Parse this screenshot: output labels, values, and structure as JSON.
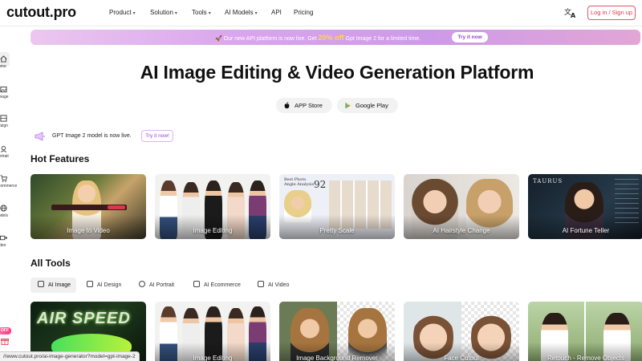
{
  "brand": {
    "logo": "cutout.pro"
  },
  "nav": {
    "items": [
      {
        "label": "Product",
        "caret": "▾"
      },
      {
        "label": "Solution",
        "caret": "▾"
      },
      {
        "label": "Tools",
        "caret": "▾"
      },
      {
        "label": "AI Models",
        "caret": "▾"
      },
      {
        "label": "API",
        "caret": ""
      },
      {
        "label": "Pricing",
        "caret": ""
      }
    ],
    "language_icon": "translate-icon",
    "login_label": "Log in / Sign up"
  },
  "sidebar": {
    "items": [
      {
        "label": "ome",
        "icon": "home-icon"
      },
      {
        "label": "mage",
        "icon": "image-icon"
      },
      {
        "label": "esign",
        "icon": "design-icon"
      },
      {
        "label": "ortrait",
        "icon": "portrait-icon"
      },
      {
        "label": "commerce",
        "icon": "cart-icon"
      },
      {
        "label": "odels",
        "icon": "models-icon"
      },
      {
        "label": "ideo",
        "icon": "video-icon"
      }
    ],
    "badge": "OFF",
    "gift_icon": "gift-icon"
  },
  "banner": {
    "prefix": "🚀 Our new API platform is now live. Get ",
    "highlight": "20% off",
    "suffix": " Gpt Image 2 for a limited time.",
    "button": "Try it now"
  },
  "hero": {
    "title": "AI Image Editing & Video Generation Platform",
    "app_store": "APP Store",
    "google_play": "Google Play"
  },
  "gpt_notice": {
    "text": "GPT Image 2 model is now live.",
    "button": "Try it now!"
  },
  "hot_features": {
    "title": "Hot Features",
    "cards": [
      {
        "label": "Image to Video"
      },
      {
        "label": "Image Editing"
      },
      {
        "label": "Pretty Scale"
      },
      {
        "label": "AI Hairstyle Change"
      },
      {
        "label": "AI Fortune Teller"
      }
    ]
  },
  "all_tools": {
    "title": "All Tools",
    "tabs": [
      {
        "label": "AI Image",
        "active": true,
        "icon": "image-icon"
      },
      {
        "label": "AI Design",
        "active": false,
        "icon": "design-icon"
      },
      {
        "label": "AI Portrait",
        "active": false,
        "icon": "portrait-icon"
      },
      {
        "label": "AI Ecommerce",
        "active": false,
        "icon": "cart-icon"
      },
      {
        "label": "AI Video",
        "active": false,
        "icon": "video-icon"
      }
    ],
    "cards": [
      {
        "label": "AIR SPEED"
      },
      {
        "label": "Image Editing"
      },
      {
        "label": "Image Background Remover"
      },
      {
        "label": "Face Cutout"
      },
      {
        "label": "Retouch - Remove Objects"
      }
    ]
  },
  "pretty_scale_card": {
    "heading": "Best Photo Angle Analysis",
    "score": "92"
  },
  "fortune_card": {
    "sign": "TAURUS"
  },
  "status_url": "//www.cutout.pro/ai-image-generator?model=gpt-image-2",
  "colors": {
    "accent": "#d83a55",
    "banner_purple": "#cd9ae8",
    "highlight_yellow": "#ffd84a"
  }
}
